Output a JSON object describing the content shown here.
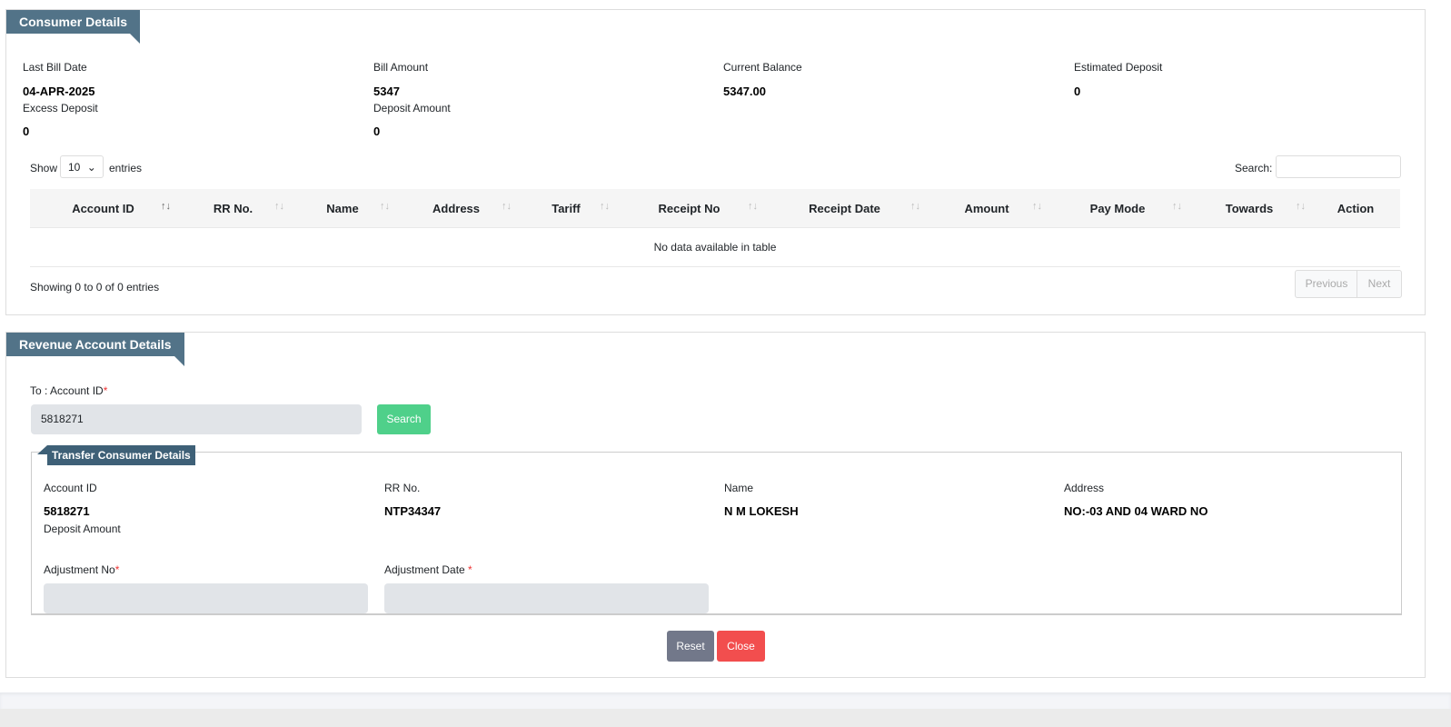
{
  "consumer": {
    "title": "Consumer Details",
    "fields": [
      {
        "label": "Last Bill Date",
        "value": "04-APR-2025"
      },
      {
        "label": "Bill Amount",
        "value": "5347"
      },
      {
        "label": "Current Balance",
        "value": "5347.00"
      },
      {
        "label": "Estimated Deposit",
        "value": "0"
      },
      {
        "label": "Excess Deposit",
        "value": "0"
      },
      {
        "label": "Deposit Amount",
        "value": "0"
      }
    ],
    "show": "Show",
    "entries_value": "10",
    "entries": "entries",
    "search_label": "Search:",
    "columns": [
      "Account ID",
      "RR No.",
      "Name",
      "Address",
      "Tariff",
      "Receipt No",
      "Receipt Date",
      "Amount",
      "Pay Mode",
      "Towards",
      "Action"
    ],
    "empty": "No data available in table",
    "info": "Showing 0 to 0 of 0 entries",
    "prev": "Previous",
    "next": "Next"
  },
  "revenue": {
    "title": "Revenue Account Details",
    "to_label": "To : Account ID",
    "req": "*",
    "account_value": "5818271",
    "search_btn": "Search",
    "transfer": {
      "title": "Transfer Consumer Details",
      "fields": [
        {
          "label": "Account ID",
          "value": "5818271"
        },
        {
          "label": "RR No.",
          "value": "NTP34347"
        },
        {
          "label": "Name",
          "value": "N M LOKESH"
        },
        {
          "label": "Address",
          "value": "NO:-03 AND 04 WARD NO"
        }
      ],
      "deposit_label": "Deposit Amount",
      "adj_no": "Adjustment No",
      "adj_date": "Adjustment Date "
    },
    "reset": "Reset",
    "close": "Close"
  }
}
